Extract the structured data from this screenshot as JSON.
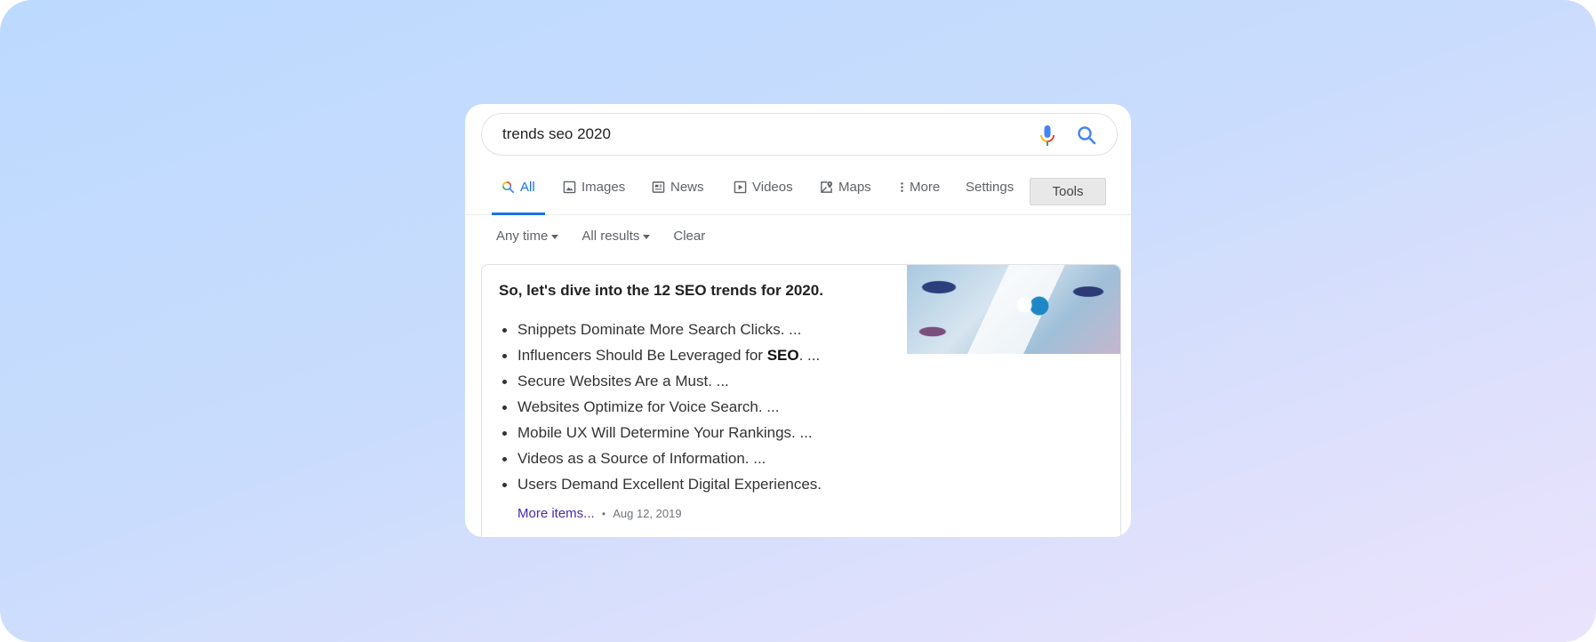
{
  "search": {
    "query": "trends seo 2020",
    "mic_icon": "microphone-icon",
    "search_icon": "search-icon"
  },
  "tabs": [
    {
      "label": "All",
      "icon": "search-icon",
      "active": true
    },
    {
      "label": "Images",
      "icon": "image-icon"
    },
    {
      "label": "News",
      "icon": "news-icon"
    },
    {
      "label": "Videos",
      "icon": "play-icon"
    },
    {
      "label": "Maps",
      "icon": "map-pin-icon"
    },
    {
      "label": "More",
      "icon": "vertical-dots-icon"
    },
    {
      "label": "Settings"
    }
  ],
  "tools_label": "Tools",
  "filters": {
    "time": "Any time",
    "results": "All results",
    "clear": "Clear"
  },
  "snippet": {
    "heading": "So, let's dive into the 12 SEO trends for 2020.",
    "items": [
      "Snippets Dominate More Search Clicks. ...",
      "Influencers Should Be Leveraged for ",
      "Secure Websites Are a Must. ...",
      "Websites Optimize for Voice Search. ...",
      "Mobile UX Will Determine Your Rankings. ...",
      "Videos as a Source of Information. ...",
      "Users Demand Excellent Digital Experiences."
    ],
    "item2_bold": "SEO",
    "item2_suffix": ". ...",
    "more_link": "More items...",
    "separator": "•",
    "date": "Aug 12, 2019",
    "thumbnail": "seo-analytics-image"
  },
  "colors": {
    "accent": "#1a73e8",
    "link_visited": "#4b2aa8",
    "bg_start": "#bcdafe",
    "bg_end": "#ebe3fd"
  }
}
